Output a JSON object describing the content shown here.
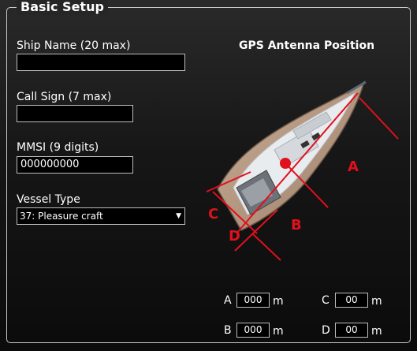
{
  "group_title": "Basic Setup",
  "ship_name": {
    "label": "Ship Name (20 max)",
    "value": ""
  },
  "call_sign": {
    "label": "Call Sign (7 max)",
    "value": ""
  },
  "mmsi": {
    "label": "MMSI (9 digits)",
    "value": "000000000"
  },
  "vessel_type": {
    "label": "Vessel Type",
    "selected": "37: Pleasure craft"
  },
  "gps": {
    "title": "GPS Antenna Position",
    "diagram_labels": {
      "A": "A",
      "B": "B",
      "C": "C",
      "D": "D"
    },
    "colors": {
      "guide": "#e0101c",
      "hull": "#b89a84",
      "deck": "#e9ecef"
    },
    "fields": {
      "A": {
        "label": "A",
        "value": "000",
        "unit": "m"
      },
      "B": {
        "label": "B",
        "value": "000",
        "unit": "m"
      },
      "C": {
        "label": "C",
        "value": "00",
        "unit": "m"
      },
      "D": {
        "label": "D",
        "value": "00",
        "unit": "m"
      }
    }
  }
}
